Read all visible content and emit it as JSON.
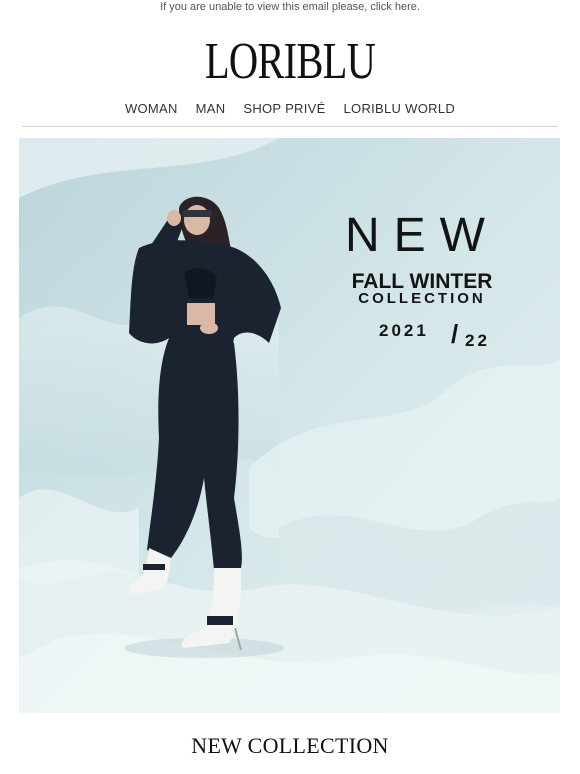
{
  "preheader": {
    "text_before": "If you are unable to view this email please, ",
    "link": "click here."
  },
  "brand": {
    "logo_text": "LORIBLU"
  },
  "nav": {
    "items": [
      {
        "label": "WOMAN"
      },
      {
        "label": "MAN"
      },
      {
        "label": "SHOP PRIVÉ"
      },
      {
        "label": "LORIBLU WORLD"
      }
    ]
  },
  "hero": {
    "headline": "NEW",
    "subhead_line1": "FALL WINTER",
    "subhead_line2": "COLLECTION",
    "year_left": "2021",
    "year_slash": "/",
    "year_right": "22",
    "colors": {
      "sky": "#cfe4e7",
      "fabric": "#e9f2f3",
      "outfit": "#1b2230",
      "boots": "#f4f4f2"
    }
  },
  "section": {
    "title": "NEW COLLECTION"
  }
}
